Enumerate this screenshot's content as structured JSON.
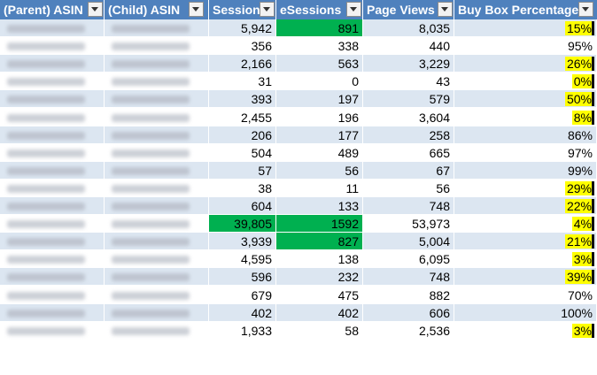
{
  "headers": [
    "(Parent) ASIN",
    "(Child) ASIN",
    "Sessions",
    "eSessions",
    "Page Views",
    "Buy Box Percentage"
  ],
  "rows": [
    {
      "sessions": "5,942",
      "esessions": "891",
      "page_views": "8,035",
      "buy_box": "15%",
      "esessions_green": true,
      "buybox_yellow": true,
      "sessions_green": false
    },
    {
      "sessions": "356",
      "esessions": "338",
      "page_views": "440",
      "buy_box": "95%",
      "esessions_green": false,
      "buybox_yellow": false,
      "sessions_green": false
    },
    {
      "sessions": "2,166",
      "esessions": "563",
      "page_views": "3,229",
      "buy_box": "26%",
      "esessions_green": false,
      "buybox_yellow": true,
      "sessions_green": false
    },
    {
      "sessions": "31",
      "esessions": "0",
      "page_views": "43",
      "buy_box": "0%",
      "esessions_green": false,
      "buybox_yellow": true,
      "sessions_green": false
    },
    {
      "sessions": "393",
      "esessions": "197",
      "page_views": "579",
      "buy_box": "50%",
      "esessions_green": false,
      "buybox_yellow": true,
      "sessions_green": false
    },
    {
      "sessions": "2,455",
      "esessions": "196",
      "page_views": "3,604",
      "buy_box": "8%",
      "esessions_green": false,
      "buybox_yellow": true,
      "sessions_green": false
    },
    {
      "sessions": "206",
      "esessions": "177",
      "page_views": "258",
      "buy_box": "86%",
      "esessions_green": false,
      "buybox_yellow": false,
      "sessions_green": false
    },
    {
      "sessions": "504",
      "esessions": "489",
      "page_views": "665",
      "buy_box": "97%",
      "esessions_green": false,
      "buybox_yellow": false,
      "sessions_green": false
    },
    {
      "sessions": "57",
      "esessions": "56",
      "page_views": "67",
      "buy_box": "99%",
      "esessions_green": false,
      "buybox_yellow": false,
      "sessions_green": false
    },
    {
      "sessions": "38",
      "esessions": "11",
      "page_views": "56",
      "buy_box": "29%",
      "esessions_green": false,
      "buybox_yellow": true,
      "sessions_green": false
    },
    {
      "sessions": "604",
      "esessions": "133",
      "page_views": "748",
      "buy_box": "22%",
      "esessions_green": false,
      "buybox_yellow": true,
      "sessions_green": false
    },
    {
      "sessions": "39,805",
      "esessions": "1592",
      "page_views": "53,973",
      "buy_box": "4%",
      "esessions_green": true,
      "buybox_yellow": true,
      "sessions_green": true
    },
    {
      "sessions": "3,939",
      "esessions": "827",
      "page_views": "5,004",
      "buy_box": "21%",
      "esessions_green": true,
      "buybox_yellow": true,
      "sessions_green": false
    },
    {
      "sessions": "4,595",
      "esessions": "138",
      "page_views": "6,095",
      "buy_box": "3%",
      "esessions_green": false,
      "buybox_yellow": true,
      "sessions_green": false
    },
    {
      "sessions": "596",
      "esessions": "232",
      "page_views": "748",
      "buy_box": "39%",
      "esessions_green": false,
      "buybox_yellow": true,
      "sessions_green": false
    },
    {
      "sessions": "679",
      "esessions": "475",
      "page_views": "882",
      "buy_box": "70%",
      "esessions_green": false,
      "buybox_yellow": false,
      "sessions_green": false
    },
    {
      "sessions": "402",
      "esessions": "402",
      "page_views": "606",
      "buy_box": "100%",
      "esessions_green": false,
      "buybox_yellow": false,
      "sessions_green": false
    },
    {
      "sessions": "1,933",
      "esessions": "58",
      "page_views": "2,536",
      "buy_box": "3%",
      "esessions_green": false,
      "buybox_yellow": true,
      "sessions_green": false
    }
  ],
  "colors": {
    "header": "#4f81bd",
    "band": "#dce6f1",
    "highlight_green": "#00b050",
    "highlight_yellow": "#ffff00"
  },
  "icons": {
    "filter": "dropdown-arrow-icon"
  }
}
